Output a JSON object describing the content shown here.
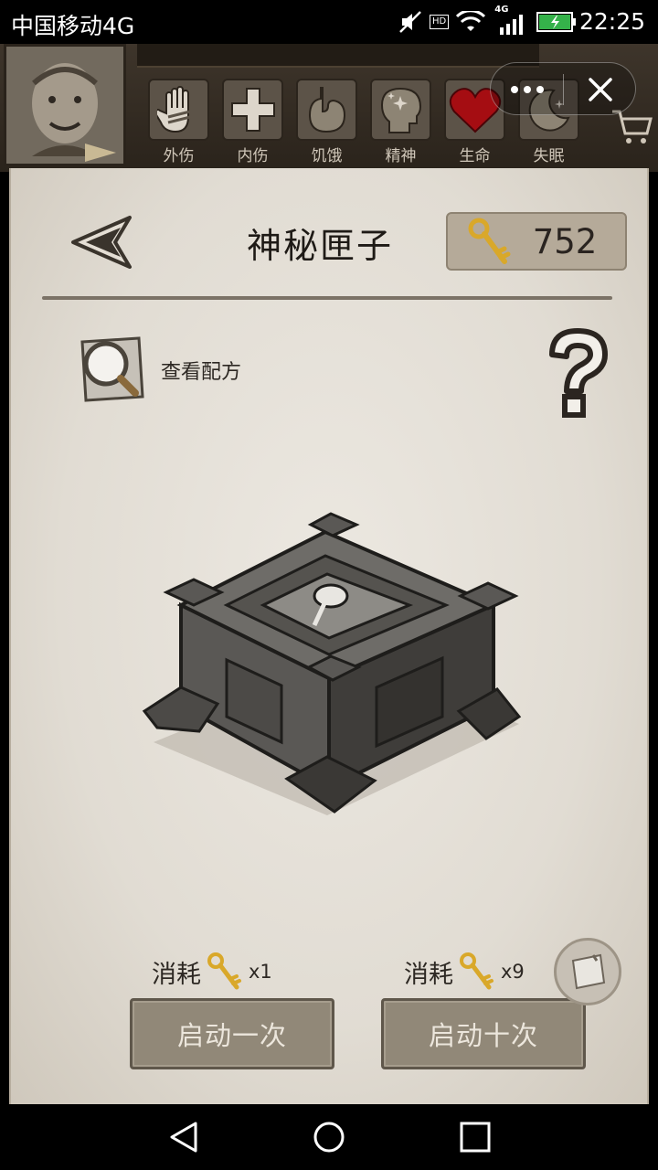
{
  "status_bar": {
    "carrier": "中国移动4G",
    "network_badge": "HD",
    "signal_badge": "4G",
    "time": "22:25"
  },
  "status_effects": [
    {
      "label": "外伤",
      "icon": "hand-icon"
    },
    {
      "label": "内伤",
      "icon": "cross-icon"
    },
    {
      "label": "饥饿",
      "icon": "stomach-icon"
    },
    {
      "label": "精神",
      "icon": "mind-icon"
    },
    {
      "label": "生命",
      "icon": "heart-icon"
    },
    {
      "label": "失眠",
      "icon": "moon-icon"
    }
  ],
  "page": {
    "title": "神秘匣子",
    "key_count": "752",
    "recipe_label": "查看配方"
  },
  "actions": {
    "single": {
      "cost_label": "消耗",
      "cost_qty": "x1",
      "button": "启动一次"
    },
    "ten": {
      "cost_label": "消耗",
      "cost_qty": "x9",
      "button": "启动十次"
    }
  },
  "colors": {
    "paper": "#e6e1d9",
    "button": "#918878",
    "heart": "#a50d12",
    "key_gold": "#d9a82a"
  }
}
